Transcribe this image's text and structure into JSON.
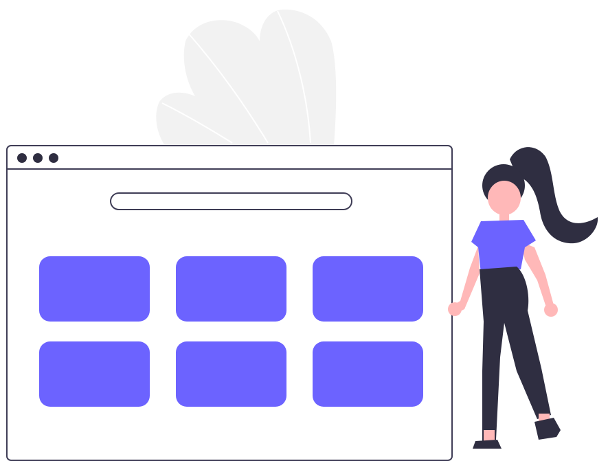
{
  "illustration": {
    "icons": {
      "decorative_leaves": "leaf-icon",
      "person": "person-icon"
    },
    "colors": {
      "accent": "#6c63ff",
      "outline": "#3f3d56",
      "dark": "#2f2e41",
      "skin": "#ffb8b8",
      "leaf": "#f2f2f2",
      "background": "#ffffff"
    },
    "browser": {
      "window_dots": 3,
      "address_bar_text": "",
      "tile_count": 6
    }
  }
}
